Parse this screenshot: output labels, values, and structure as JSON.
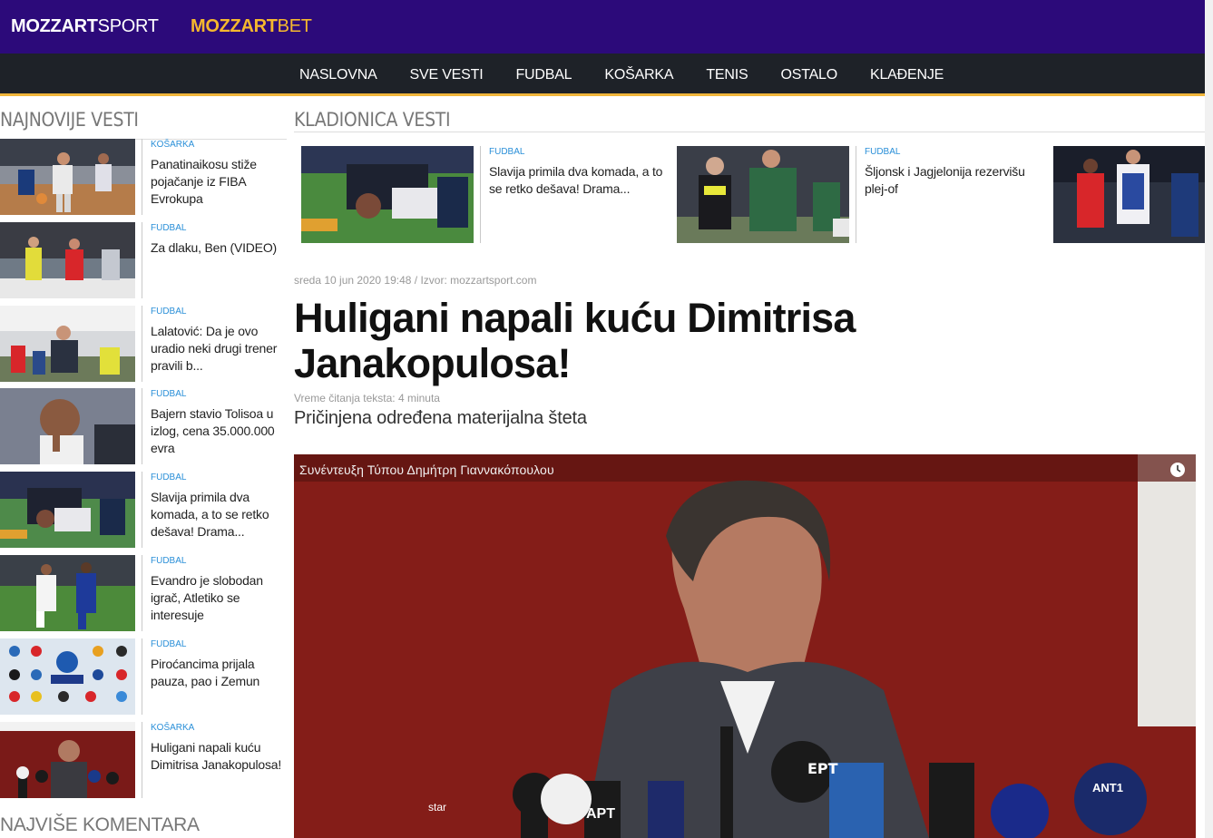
{
  "topbar": {
    "logo_sport_bold": "MOZZART",
    "logo_sport_thin": "SPORT",
    "logo_bet_bold": "MOZZART",
    "logo_bet_thin": "BET"
  },
  "nav": {
    "items": [
      {
        "label": "NASLOVNA"
      },
      {
        "label": "SVE VESTI"
      },
      {
        "label": "FUDBAL"
      },
      {
        "label": "KOŠARKA"
      },
      {
        "label": "TENIS"
      },
      {
        "label": "OSTALO"
      },
      {
        "label": "KLAĐENJE"
      }
    ]
  },
  "sidebar": {
    "title": "NAJNOVIJE VESTI",
    "items": [
      {
        "category": "KOŠARKA",
        "title": "Panatinaikosu stiže pojačanje iz FIBA Evrokupa"
      },
      {
        "category": "FUDBAL",
        "title": "Za dlaku, Ben (VIDEO)"
      },
      {
        "category": "FUDBAL",
        "title": "Lalatović: Da je ovo uradio neki drugi trener pravili b..."
      },
      {
        "category": "FUDBAL",
        "title": "Bajern stavio Tolisoa u izlog, cena 35.000.000 evra"
      },
      {
        "category": "FUDBAL",
        "title": "Slavija primila dva komada, a to se retko dešava! Drama..."
      },
      {
        "category": "FUDBAL",
        "title": "Evandro je slobodan igrač, Atletiko se interesuje"
      },
      {
        "category": "FUDBAL",
        "title": "Piroćancima prijala pauza, pao i Zemun"
      },
      {
        "category": "KOŠARKA",
        "title": "Huligani napali kuću Dimitrisa Janakopulosa!"
      }
    ],
    "most_comments_title": "NAJVIŠE KOMENTARA"
  },
  "main": {
    "section_title": "KLADIONICA VESTI",
    "featured": [
      {
        "category": "FUDBAL",
        "title": "Slavija primila dva komada, a to se retko dešava! Drama..."
      },
      {
        "category": "FUDBAL",
        "title": "Šljonsk i Jagjelonija rezervišu plej-of"
      },
      {
        "category": "",
        "title": ""
      }
    ],
    "meta": "sreda 10 jun 2020 19:48 / Izvor: mozzartsport.com",
    "headline": "Huligani napali kuću Dimitrisa Janakopulosa!",
    "reading_time": "Vreme čitanja teksta: 4 minuta",
    "subtitle": "Pričinjena određena materijalna šteta",
    "video": {
      "title": "Συνέντευξη Τύπου Δημήτρη Γιαννακόπουλου",
      "mic_labels": [
        "EPT",
        "ANT1",
        "star",
        "ΑΡΤ"
      ]
    }
  },
  "colors": {
    "topbar": "#2c0a7a",
    "nav": "#1e2228",
    "accent": "#f0b53a",
    "category": "#2a8fd8"
  }
}
